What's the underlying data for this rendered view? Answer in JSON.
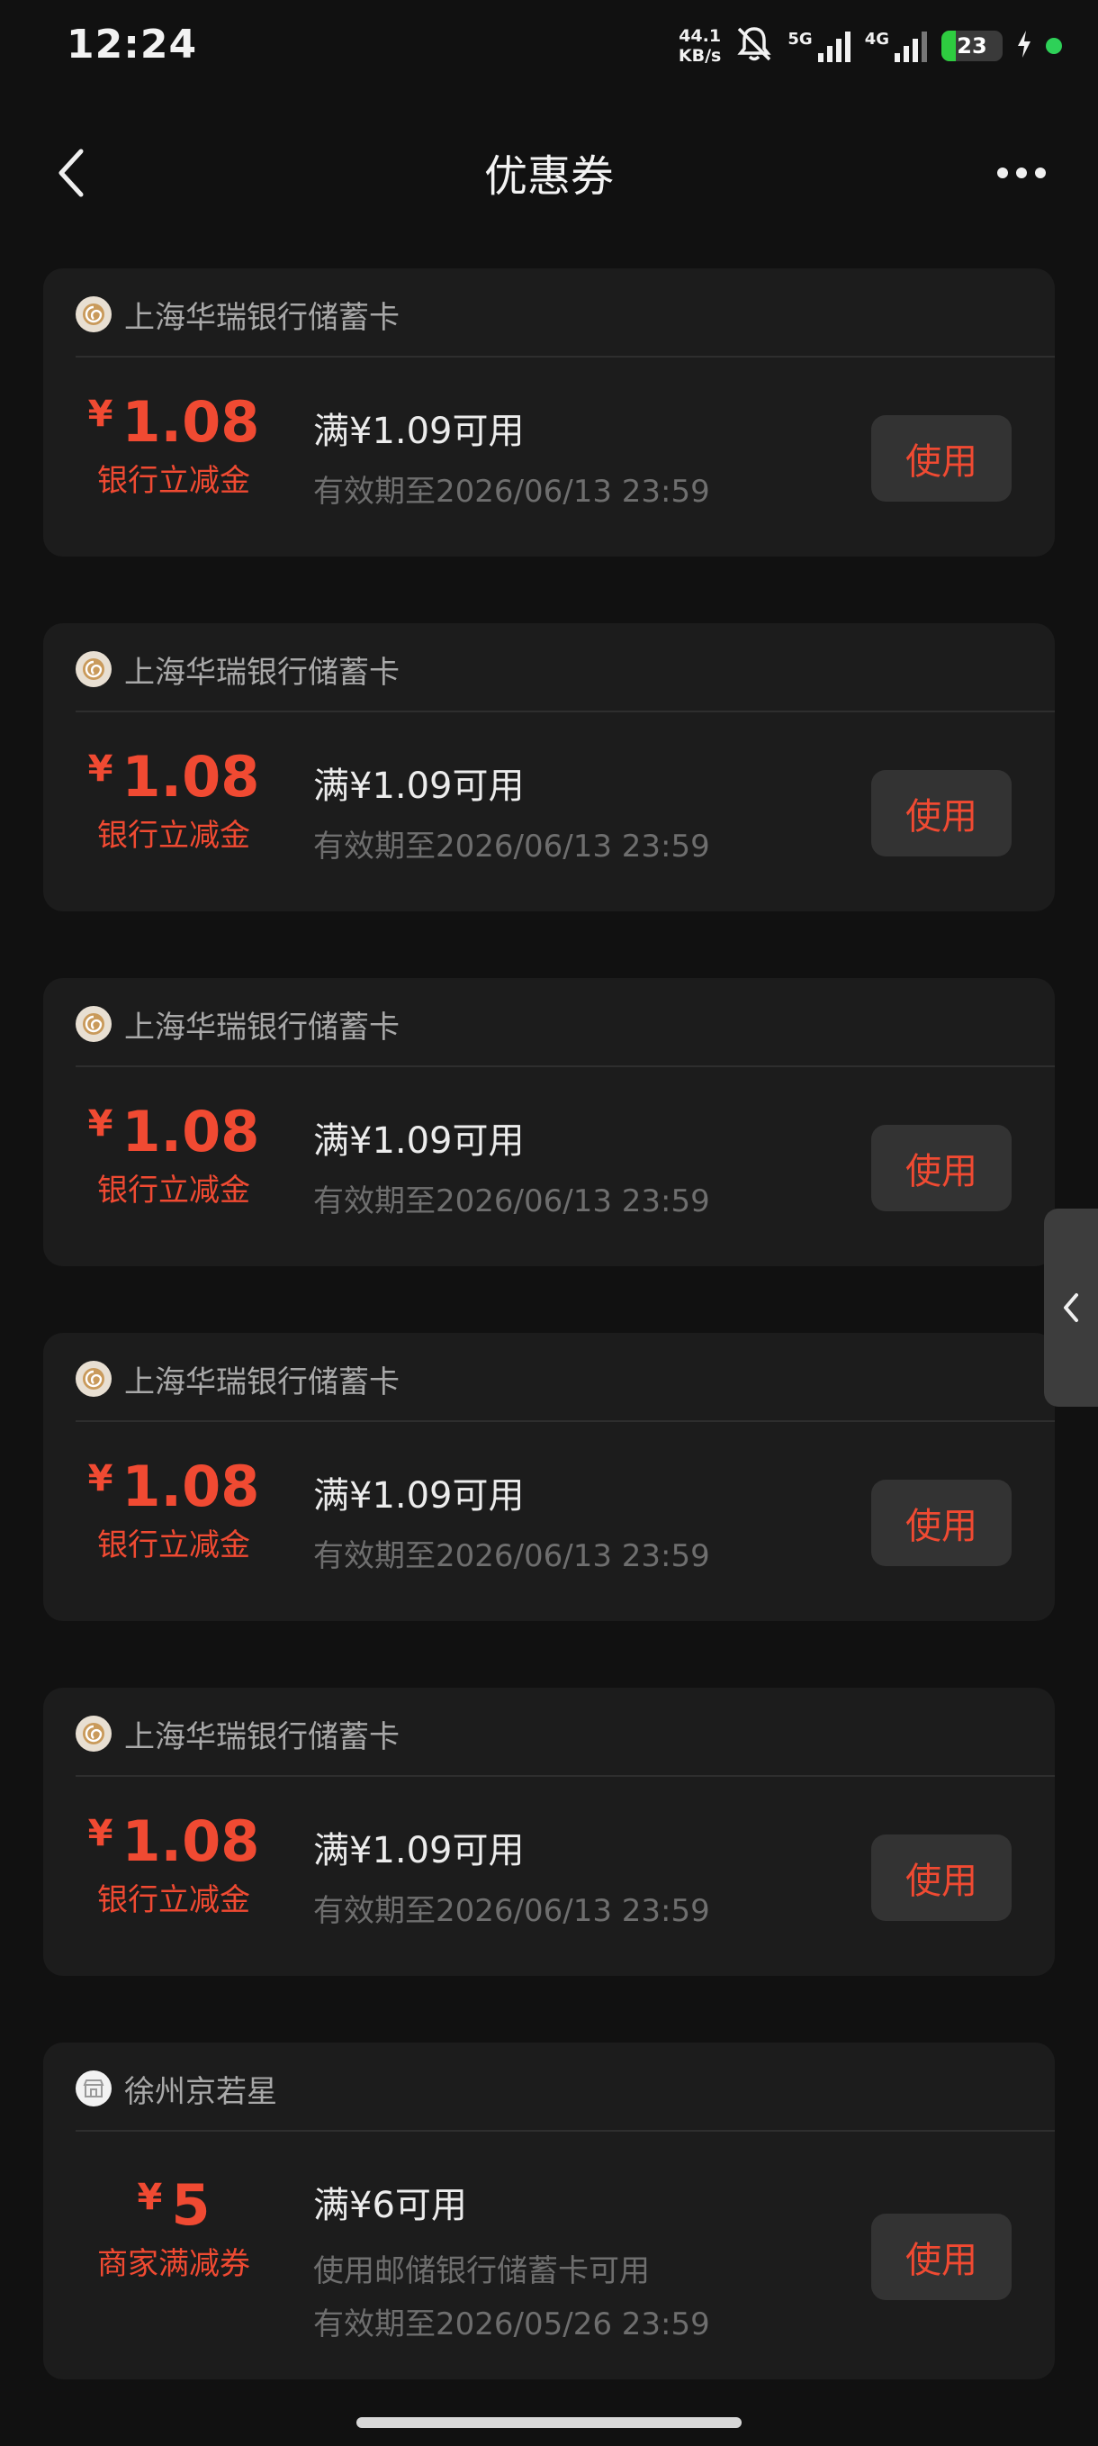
{
  "status_bar": {
    "time": "12:24",
    "net_speed_value": "44.1",
    "net_speed_unit": "KB/s",
    "sim1_label": "5G",
    "sim2_label": "4G",
    "battery_level": "23",
    "battery_fraction": 0.23
  },
  "nav": {
    "title": "优惠券"
  },
  "coupons": [
    {
      "merchant": "上海华瑞银行储蓄卡",
      "currency": "¥",
      "amount": "1.08",
      "type": "银行立减金",
      "condition": "满¥1.09可用",
      "validity": "有效期至2026/06/13 23:59",
      "button": "使用"
    },
    {
      "merchant": "上海华瑞银行储蓄卡",
      "currency": "¥",
      "amount": "1.08",
      "type": "银行立减金",
      "condition": "满¥1.09可用",
      "validity": "有效期至2026/06/13 23:59",
      "button": "使用"
    },
    {
      "merchant": "上海华瑞银行储蓄卡",
      "currency": "¥",
      "amount": "1.08",
      "type": "银行立减金",
      "condition": "满¥1.09可用",
      "validity": "有效期至2026/06/13 23:59",
      "button": "使用"
    },
    {
      "merchant": "上海华瑞银行储蓄卡",
      "currency": "¥",
      "amount": "1.08",
      "type": "银行立减金",
      "condition": "满¥1.09可用",
      "validity": "有效期至2026/06/13 23:59",
      "button": "使用"
    },
    {
      "merchant": "上海华瑞银行储蓄卡",
      "currency": "¥",
      "amount": "1.08",
      "type": "银行立减金",
      "condition": "满¥1.09可用",
      "validity": "有效期至2026/06/13 23:59",
      "button": "使用"
    },
    {
      "merchant": "徐州京若星",
      "currency": "¥",
      "amount": "5",
      "type": "商家满减券",
      "condition": "满¥6可用",
      "note": "使用邮储银行储蓄卡可用",
      "validity": "有效期至2026/05/26 23:59",
      "button": "使用"
    }
  ],
  "colors": {
    "accent": "#f04a32",
    "background": "#111111",
    "card": "#1c1c1c",
    "button": "#333333",
    "battery_green": "#2ecc40"
  },
  "icons": {
    "back": "chevron-left-icon",
    "more": "more-dots-icon",
    "mute": "bell-off-icon",
    "side_tab": "chevron-left-icon"
  }
}
